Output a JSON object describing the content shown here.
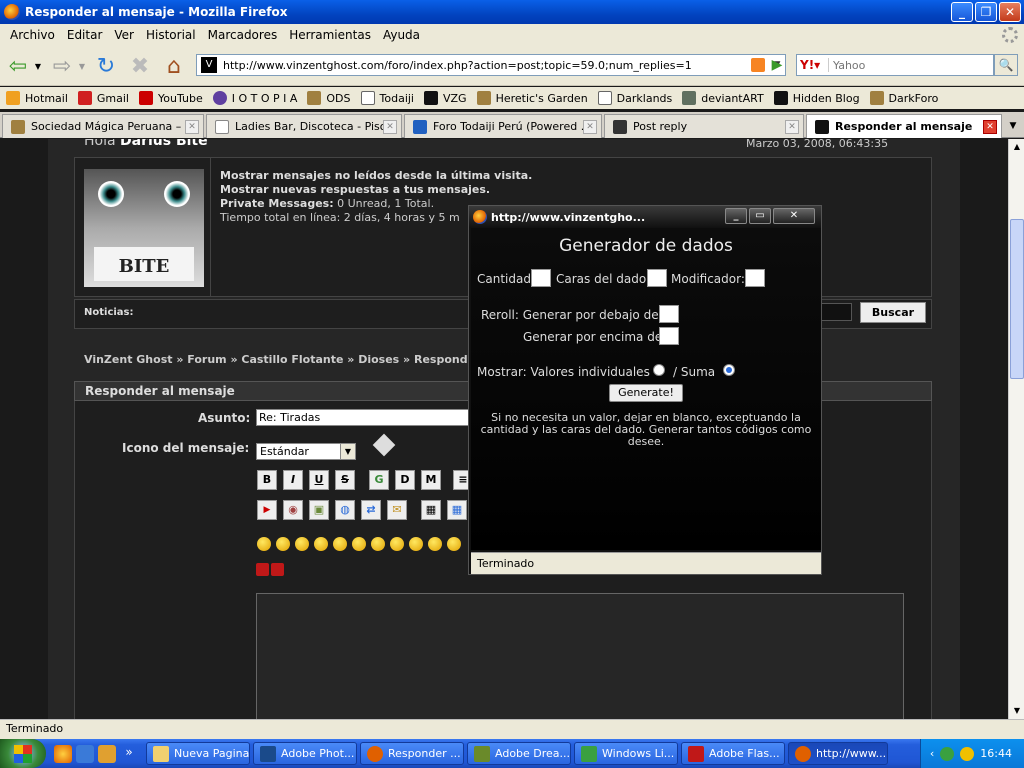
{
  "window": {
    "title": "Responder al mensaje - Mozilla Firefox"
  },
  "menu": [
    "Archivo",
    "Editar",
    "Ver",
    "Historial",
    "Marcadores",
    "Herramientas",
    "Ayuda"
  ],
  "nav": {
    "url": "http://www.vinzentghost.com/foro/index.php?action=post;topic=59.0;num_replies=1",
    "search_placeholder": "Yahoo"
  },
  "bookmarks": [
    "Hotmail",
    "Gmail",
    "YouTube",
    "I O T O P I A",
    "ODS",
    "Todaiji",
    "VZG",
    "Heretic's Garden",
    "Darklands",
    "deviantART",
    "Hidden Blog",
    "DarkForo"
  ],
  "tabs": [
    {
      "label": "Sociedad Mágica Peruana – ..."
    },
    {
      "label": "Ladies Bar, Discoteca - Piso ..."
    },
    {
      "label": "Foro Todaiji Perú (Powered ..."
    },
    {
      "label": "Post reply"
    },
    {
      "label": "Responder al mensaje"
    }
  ],
  "forum": {
    "greeting_prefix": "Hola",
    "username": "Darius Bite",
    "date": "Marzo 03, 2008, 06:43:35",
    "avatar_text": "BITE",
    "info_line1": "Mostrar mensajes no leídos desde la última visita.",
    "info_line2": "Mostrar nuevas respuestas a tus mensajes.",
    "pm_label": "Private Messages:",
    "pm_value": "0 Unread, 1 Total.",
    "online_time": "Tiempo total en línea: 2 días, 4 horas y 5 m",
    "news_label": "Noticias:",
    "search_button": "Buscar",
    "breadcrumb": "VinZent Ghost » Forum » Castillo Flotante » Dioses » Responder al m",
    "section_header": "Responder al mensaje",
    "subject_label": "Asunto:",
    "subject_value": "Re: Tiradas",
    "icon_label": "Icono del mensaje:",
    "icon_select": "Estándar"
  },
  "popup": {
    "title": "http://www.vinzentgho...",
    "heading": "Generador de dados",
    "cantidad": "Cantidad",
    "caras": "Caras del dado",
    "modificador": "Modificador:",
    "reroll_below": "Reroll: Generar por debajo de",
    "reroll_above": "Generar por encima de",
    "mostrar": "Mostrar: Valores individuales",
    "suma": "/ Suma",
    "button": "Generate!",
    "help": "Si no necesita un valor, dejar en blanco, exceptuando la cantidad y las caras del dado. Generar tantos códigos como desee.",
    "status": "Terminado"
  },
  "status": "Terminado",
  "taskbar": {
    "items": [
      "Nueva Pagina",
      "Adobe Phot...",
      "Responder ...",
      "Adobe Drea...",
      "Windows Li...",
      "Adobe Flas...",
      "http://www..."
    ],
    "clock": "16:44"
  }
}
